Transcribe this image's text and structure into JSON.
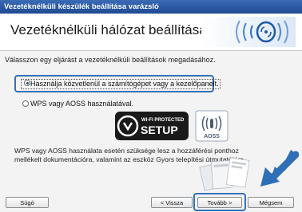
{
  "window": {
    "title": "Vezetéknélküli készülék beállítása varázsló"
  },
  "header": {
    "title": "Vezetéknélküli hálózat beállítása"
  },
  "description": "Válasszon egy eljárást a vezetéknélküli beállítások megadásához.",
  "options": [
    {
      "label": "Használja közvetlenül a számítógépet vagy a kezelőpanelt.",
      "selected": true
    },
    {
      "label": "WPS vagy AOSS használatával.",
      "selected": false
    }
  ],
  "logos": {
    "wps_small": "WI-FI PROTECTED",
    "wps_big": "SETUP",
    "aoss": "AOSS"
  },
  "note": "WPS vagy AOSS használata esetén szüksége lesz a hozzáférési ponthoz mellékelt dokumentációra, valamint az eszköz Gyors telepítési útmutatójára.",
  "buttons": {
    "help": "Súgó",
    "back": "< Vissza",
    "next": "Tovább >",
    "cancel": "Mégsem"
  },
  "colors": {
    "titlebar": "#2a5aa5",
    "highlight": "#3470b8",
    "arrow": "#2e6fb7"
  },
  "icons": [
    "wifi-signal-icon",
    "wps-logo-icon",
    "aoss-logo-icon",
    "arrow-icon",
    "documents-icon"
  ]
}
